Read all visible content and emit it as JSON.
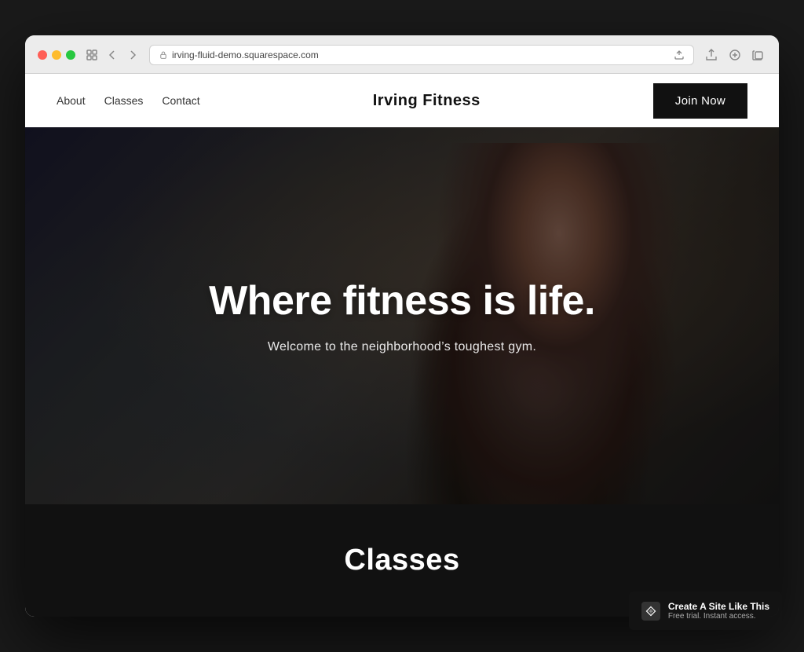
{
  "browser": {
    "url": "irving-fluid-demo.squarespace.com",
    "traffic_lights": [
      "red",
      "yellow",
      "green"
    ]
  },
  "nav": {
    "links": [
      {
        "label": "About",
        "id": "about"
      },
      {
        "label": "Classes",
        "id": "classes"
      },
      {
        "label": "Contact",
        "id": "contact"
      }
    ],
    "brand": "Irving Fitness",
    "cta_label": "Join Now"
  },
  "hero": {
    "title": "Where fitness is life.",
    "subtitle": "Welcome to the neighborhood’s toughest gym."
  },
  "classes_section": {
    "title": "Classes"
  },
  "badge": {
    "main_text": "Create A Site Like This",
    "sub_text": "Free trial. Instant access."
  }
}
